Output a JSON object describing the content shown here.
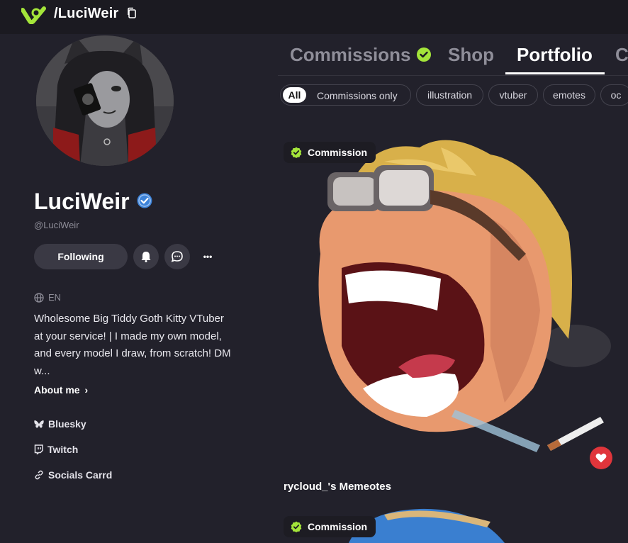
{
  "header": {
    "handle_title": "/LuciWeir"
  },
  "profile": {
    "name": "LuciWeir",
    "handle": "@LuciWeir",
    "follow_label": "Following",
    "more_label": "•••",
    "language": "EN",
    "bio": "Wholesome Big Tiddy Goth Kitty VTuber at your service! | I made my own model, and every model I draw, from scratch! DM w...",
    "about_label": "About me",
    "links": [
      "Bluesky",
      "Twitch",
      "Socials Carrd"
    ]
  },
  "tabs": [
    "Commissions",
    "Shop",
    "Portfolio",
    "C"
  ],
  "active_tab": "Portfolio",
  "filters": [
    "All",
    "Commissions only",
    "illustration",
    "vtuber",
    "emotes",
    "oc"
  ],
  "portfolio": [
    {
      "badge": "Commission",
      "title": "rycloud_'s Memeotes"
    },
    {
      "badge": "Commission"
    }
  ],
  "colors": {
    "accent_green": "#a4e53a",
    "verified_blue": "#3d83d9",
    "heart_red": "#e0353b"
  },
  "icons": [
    "logo-icon",
    "copy-icon",
    "verified-icon",
    "bell-icon",
    "chat-icon",
    "globe-icon",
    "bluesky-icon",
    "twitch-icon",
    "link-icon",
    "check-badge-icon",
    "heart-icon"
  ]
}
